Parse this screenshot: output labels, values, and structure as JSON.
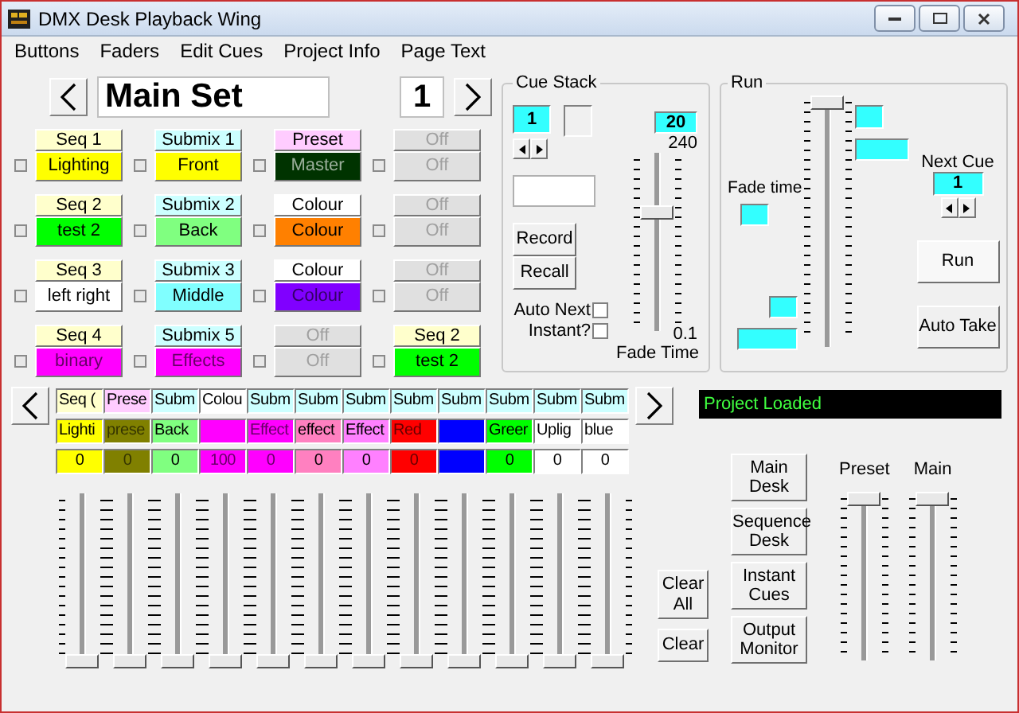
{
  "window": {
    "title": "DMX Desk Playback Wing"
  },
  "menu": [
    "Buttons",
    "Faders",
    "Edit Cues",
    "Project Info",
    "Page Text"
  ],
  "page": {
    "name": "Main Set",
    "number": "1"
  },
  "buttons": [
    {
      "header": {
        "text": "Seq 1",
        "color": "#ffffcc"
      },
      "main": {
        "text": "Lighting",
        "color": "#ffff00"
      },
      "checked": false,
      "disabled": false
    },
    {
      "header": {
        "text": "Submix 1",
        "color": "#ccffff"
      },
      "main": {
        "text": "Front",
        "color": "#ffff00"
      },
      "checked": false,
      "disabled": false
    },
    {
      "header": {
        "text": "Preset",
        "color": "#ffccff"
      },
      "main": {
        "text": "Master",
        "color": "#003300"
      },
      "checked": false,
      "disabled": false
    },
    {
      "header": {
        "text": "Off",
        "color": "#e0e0e0"
      },
      "main": {
        "text": "Off",
        "color": "#e0e0e0"
      },
      "checked": false,
      "disabled": true
    },
    {
      "header": {
        "text": "Seq 2",
        "color": "#ffffcc"
      },
      "main": {
        "text": "test 2",
        "color": "#00ff00"
      },
      "checked": false,
      "disabled": false
    },
    {
      "header": {
        "text": "Submix 2",
        "color": "#ccffff"
      },
      "main": {
        "text": "Back",
        "color": "#80ff80"
      },
      "checked": false,
      "disabled": false
    },
    {
      "header": {
        "text": "Colour",
        "color": "#ffffff"
      },
      "main": {
        "text": "Colour",
        "color": "#ff8000"
      },
      "checked": false,
      "disabled": false
    },
    {
      "header": {
        "text": "Off",
        "color": "#e0e0e0"
      },
      "main": {
        "text": "Off",
        "color": "#e0e0e0"
      },
      "checked": false,
      "disabled": true
    },
    {
      "header": {
        "text": "Seq 3",
        "color": "#ffffcc"
      },
      "main": {
        "text": "left right",
        "color": "#ffffff"
      },
      "checked": false,
      "disabled": false
    },
    {
      "header": {
        "text": "Submix 3",
        "color": "#ccffff"
      },
      "main": {
        "text": "Middle",
        "color": "#80ffff"
      },
      "checked": false,
      "disabled": false
    },
    {
      "header": {
        "text": "Colour",
        "color": "#ffffff"
      },
      "main": {
        "text": "Colour",
        "color": "#8000ff"
      },
      "checked": false,
      "disabled": false
    },
    {
      "header": {
        "text": "Off",
        "color": "#e0e0e0"
      },
      "main": {
        "text": "Off",
        "color": "#e0e0e0"
      },
      "checked": false,
      "disabled": true
    },
    {
      "header": {
        "text": "Seq 4",
        "color": "#ffffcc"
      },
      "main": {
        "text": "binary",
        "color": "#ff00ff"
      },
      "checked": false,
      "disabled": false
    },
    {
      "header": {
        "text": "Submix 5",
        "color": "#ccffff"
      },
      "main": {
        "text": "Effects",
        "color": "#ff00ff"
      },
      "checked": false,
      "disabled": false
    },
    {
      "header": {
        "text": "Off",
        "color": "#e0e0e0"
      },
      "main": {
        "text": "Off",
        "color": "#e0e0e0"
      },
      "checked": false,
      "disabled": true
    },
    {
      "header": {
        "text": "Seq 2",
        "color": "#ffffcc"
      },
      "main": {
        "text": "test 2",
        "color": "#00ff00"
      },
      "checked": false,
      "disabled": false
    }
  ],
  "cue_stack": {
    "title": "Cue Stack",
    "cue": "1",
    "fade": "20",
    "max": "240",
    "min": "0.1",
    "fade_label": "Fade Time",
    "level": 0.68,
    "record": "Record",
    "recall": "Recall",
    "auto_next": {
      "label": "Auto Next",
      "checked": false
    },
    "instant": {
      "label": "Instant?",
      "checked": false
    }
  },
  "run": {
    "title": "Run",
    "level": 1,
    "fade_label": "Fade time",
    "next_cue_label": "Next Cue",
    "next_cue": "1",
    "run_button": "Run",
    "auto_take_button": "Auto Take"
  },
  "channels": [
    {
      "header": {
        "text": "Seq (",
        "color": "#ffffcc"
      },
      "name": "Lighti",
      "color": "#ffff00",
      "value": "0",
      "level": 0
    },
    {
      "header": {
        "text": "Prese",
        "color": "#ffccff"
      },
      "name": "prese",
      "color": "#808000",
      "value": "0",
      "level": 0
    },
    {
      "header": {
        "text": "Subm",
        "color": "#ccffff"
      },
      "name": "Back",
      "color": "#80ff80",
      "value": "0",
      "level": 0
    },
    {
      "header": {
        "text": "Colou",
        "color": "#ffffff"
      },
      "color": "#ff00ff",
      "value": "100",
      "level": 0
    },
    {
      "header": {
        "text": "Subm",
        "color": "#ccffff"
      },
      "name": "Effect",
      "color": "#ff00ff",
      "value": "0",
      "level": 0
    },
    {
      "header": {
        "text": "Subm",
        "color": "#ccffff"
      },
      "name": "effect",
      "color": "#ff80c0",
      "value": "0",
      "level": 0
    },
    {
      "header": {
        "text": "Subm",
        "color": "#ccffff"
      },
      "name": "Effect",
      "color": "#ff80ff",
      "value": "0",
      "level": 0
    },
    {
      "header": {
        "text": "Subm",
        "color": "#ccffff"
      },
      "name": "Red",
      "color": "#ff0000",
      "value": "0",
      "level": 0
    },
    {
      "header": {
        "text": "Subm",
        "color": "#ccffff"
      },
      "color": "#0000ff",
      "level": 0
    },
    {
      "header": {
        "text": "Subm",
        "color": "#ccffff"
      },
      "name": "Greer",
      "color": "#00ff00",
      "value": "0",
      "level": 0
    },
    {
      "header": {
        "text": "Subm",
        "color": "#ccffff"
      },
      "name": "Uplig",
      "color": "#ffffff",
      "value": "0",
      "level": 0
    },
    {
      "header": {
        "text": "Subm",
        "color": "#ccffff"
      },
      "name": "blue",
      "color": "#ffffff",
      "value": "0",
      "level": 0
    }
  ],
  "clear_all": "Clear All",
  "clear": "Clear",
  "status": "Project Loaded",
  "desk_buttons": [
    "Main Desk",
    "Sequence Desk",
    "Instant Cues",
    "Output Monitor"
  ],
  "masters": [
    {
      "label": "Preset",
      "level": 1
    },
    {
      "label": "Main",
      "level": 1
    }
  ]
}
